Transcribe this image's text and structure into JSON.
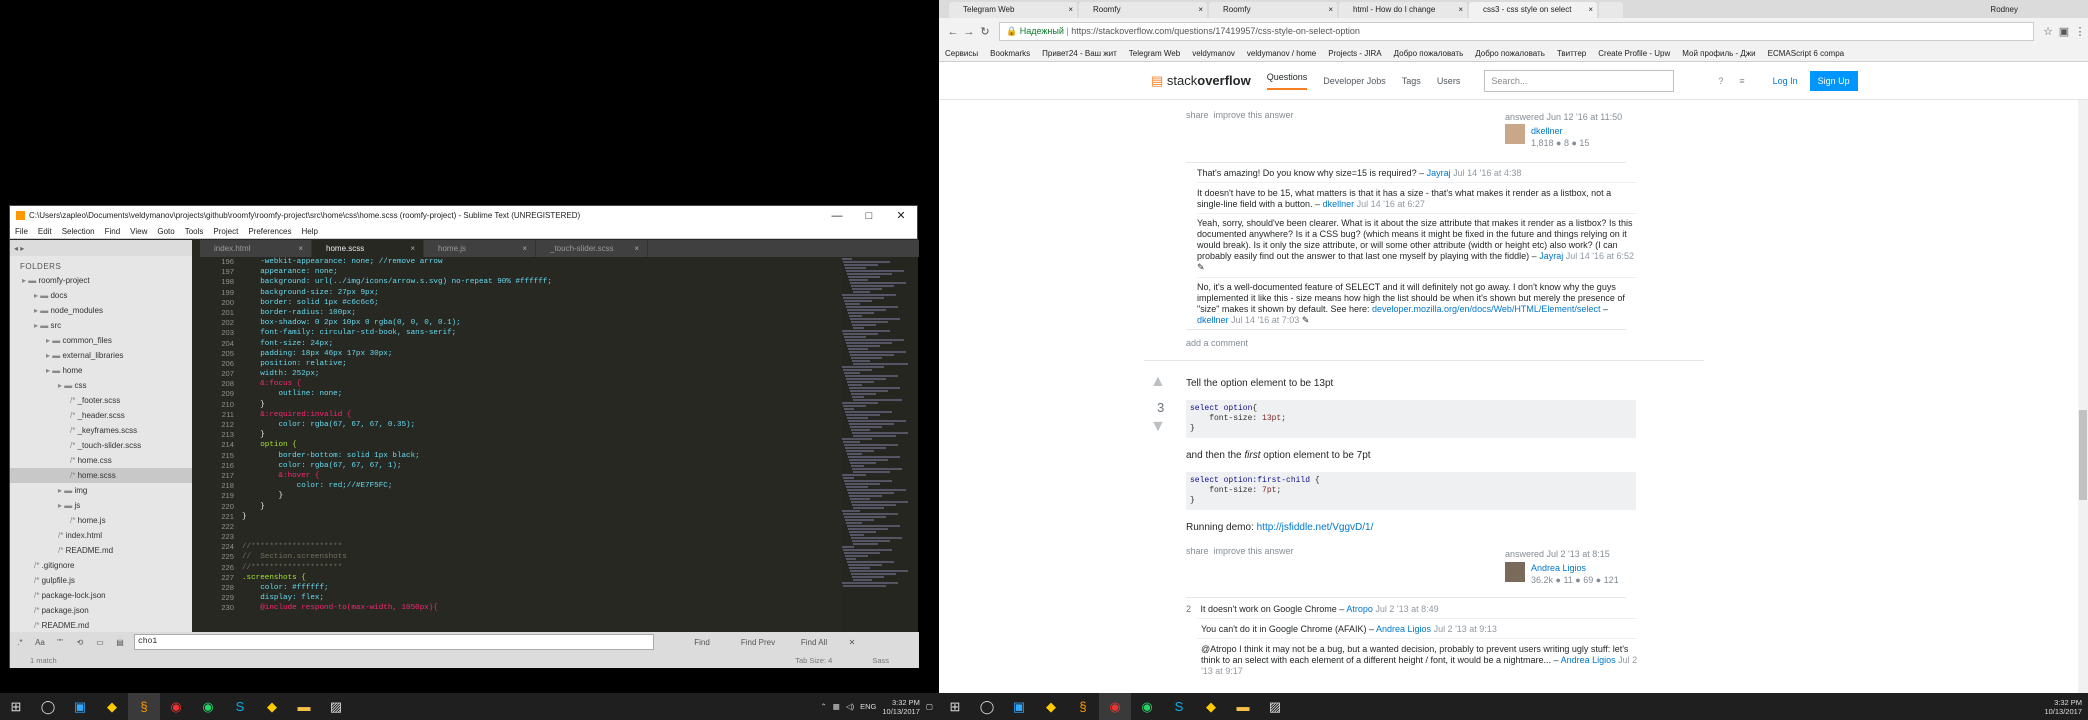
{
  "sublime": {
    "title": "C:\\Users\\zapleo\\Documents\\veldymanov\\projects\\github\\roomfy\\roomfy-project\\src\\home\\css\\home.scss (roomfy-project) - Sublime Text (UNREGISTERED)",
    "menu": [
      "File",
      "Edit",
      "Selection",
      "Find",
      "View",
      "Goto",
      "Tools",
      "Project",
      "Preferences",
      "Help"
    ],
    "folders_heading": "FOLDERS",
    "tree": [
      {
        "label": "roomfy-project",
        "indent": 1,
        "sel": false
      },
      {
        "label": "docs",
        "indent": 2,
        "sel": false
      },
      {
        "label": "node_modules",
        "indent": 2,
        "sel": false
      },
      {
        "label": "src",
        "indent": 2,
        "sel": false
      },
      {
        "label": "common_files",
        "indent": 3,
        "sel": false
      },
      {
        "label": "external_libraries",
        "indent": 3,
        "sel": false
      },
      {
        "label": "home",
        "indent": 3,
        "sel": false
      },
      {
        "label": "css",
        "indent": 4,
        "sel": false
      },
      {
        "label": "_footer.scss",
        "indent": 5,
        "sel": false
      },
      {
        "label": "_header.scss",
        "indent": 5,
        "sel": false
      },
      {
        "label": "_keyframes.scss",
        "indent": 5,
        "sel": false
      },
      {
        "label": "_touch-slider.scss",
        "indent": 5,
        "sel": false
      },
      {
        "label": "home.css",
        "indent": 5,
        "sel": false
      },
      {
        "label": "home.scss",
        "indent": 5,
        "sel": true
      },
      {
        "label": "img",
        "indent": 4,
        "sel": false
      },
      {
        "label": "js",
        "indent": 4,
        "sel": false
      },
      {
        "label": "home.js",
        "indent": 5,
        "sel": false
      },
      {
        "label": "index.html",
        "indent": 4,
        "sel": false
      },
      {
        "label": "README.md",
        "indent": 4,
        "sel": false
      },
      {
        "label": ".gitignore",
        "indent": 2,
        "sel": false
      },
      {
        "label": "gulpfile.js",
        "indent": 2,
        "sel": false
      },
      {
        "label": "package-lock.json",
        "indent": 2,
        "sel": false
      },
      {
        "label": "package.json",
        "indent": 2,
        "sel": false
      },
      {
        "label": "README.md",
        "indent": 2,
        "sel": false
      }
    ],
    "tabs": [
      {
        "label": "index.html",
        "active": false
      },
      {
        "label": "home.scss",
        "active": true
      },
      {
        "label": "home.js",
        "active": false
      },
      {
        "label": "_touch-slider.scss",
        "active": false
      }
    ],
    "line_start": 196,
    "code_lines": [
      "    -webkit-appearance: none; //remove arrow",
      "    appearance: none;",
      "    background: url(../img/icons/arrow.s.svg) no-repeat 90% #ffffff;",
      "    background-size: 27px 9px;",
      "    border: solid 1px #c6c6c6;",
      "    border-radius: 100px;",
      "    box-shadow: 0 2px 10px 0 rgba(0, 0, 0, 0.1);",
      "    font-family: circular-std-book, sans-serif;",
      "    font-size: 24px;",
      "    padding: 18px 46px 17px 30px;",
      "    position: relative;",
      "    width: 252px;",
      "    &:focus {",
      "        outline: none;",
      "    }",
      "    &:required:invalid {",
      "        color: rgba(67, 67, 67, 0.35);",
      "    }",
      "    option {",
      "        border-bottom: solid 1px black;",
      "        color: rgba(67, 67, 67, 1);",
      "        &:hover {",
      "            color: red;//#E7F5FC;",
      "        }",
      "    }",
      "}",
      "",
      "",
      "//********************",
      "//  Section.screenshots",
      "//********************",
      ".screenshots {",
      "    color: #ffffff;",
      "    display: flex;",
      "    @include respond-to(max-width, 1050px){"
    ],
    "find_value": "cho1",
    "find_btn": "Find",
    "find_prev_btn": "Find Prev",
    "find_all_btn": "Find All",
    "status_left": "1 match",
    "status_tab": "Tab Size: 4",
    "status_syntax": "Sass"
  },
  "taskbar": {
    "lang": "ENG",
    "time": "3:32 PM",
    "date": "10/13/2017"
  },
  "browser": {
    "tabs": [
      {
        "label": "Telegram Web",
        "active": false
      },
      {
        "label": "Roomfy",
        "active": false
      },
      {
        "label": "Roomfy",
        "active": false
      },
      {
        "label": "html - How do I change",
        "active": false
      },
      {
        "label": "css3 - css style on select",
        "active": true
      }
    ],
    "user": "Rodney",
    "secure_label": "Надежный",
    "url": "https://stackoverflow.com/questions/17419957/css-style-on-select-option",
    "bookmarks": [
      "Сервисы",
      "Bookmarks",
      "Привет24 - Ваш жит",
      "Telegram Web",
      "veldymanov",
      "veldymanov / home",
      "Projects - JIRA",
      "Добро пожаловать",
      "Добро пожаловать",
      "Твиттер",
      "Create Profile - Upw",
      "Мой профиль - Джи",
      "ECMAScript 6 compa"
    ]
  },
  "so": {
    "logo_a": "stack",
    "logo_b": "overflow",
    "nav": [
      "Questions",
      "Developer Jobs",
      "Tags",
      "Users"
    ],
    "search_placeholder": "Search...",
    "login": "Log In",
    "signup": "Sign Up",
    "ans1": {
      "share": "share",
      "improve": "improve this answer",
      "answered": "answered Jun 12 '16 at 11:50",
      "user": "dkellner",
      "rep": "1,818 ● 8 ● 15"
    },
    "comments1": [
      {
        "text": "That's amazing! Do you know why size=15 is required? –",
        "user": "Jayraj",
        "date": "Jul 14 '16 at 4:38"
      },
      {
        "text": "It doesn't have to be 15, what matters is that it has a size - that's what makes it render as a listbox, not a single-line field with a button. –",
        "user": "dkellner",
        "date": "Jul 14 '16 at 6:27"
      },
      {
        "text": "Yeah, sorry, should've been clearer. What is it about the size attribute that makes it render as a listbox? Is this documented anywhere? Is it a CSS bug? (which means it might be fixed in the future and things relying on it would break). Is it only the size attribute, or will some other attribute (width or height etc) also work? (I can probably easily find out the answer to that last one myself by playing with the fiddle) –",
        "user": "Jayraj",
        "date": "Jul 14 '16 at 6:52"
      },
      {
        "text": "No, it's a well-documented feature of SELECT and it will definitely not go away. I don't know why the guys implemented it like this - size means how high the list should be when it's shown but merely the presence of \"size\" makes it shown by default. See here:",
        "link": "developer.mozilla.org/en/docs/Web/HTML/Element/select",
        "user": "dkellner",
        "date": "Jul 14 '16 at 7:03"
      }
    ],
    "add_comment": "add a comment",
    "ans2": {
      "votes": "3",
      "p1": "Tell the option element to be 13pt",
      "code1_sel": "select option",
      "code1_prop": "font-size",
      "code1_val": "13pt",
      "p2_a": "and then the ",
      "p2_em": "first",
      "p2_b": " option element to be 7pt",
      "code2_sel": "select option:first-child",
      "code2_prop": "font-size",
      "code2_val": "7pt",
      "demo_label": "Running demo:",
      "demo_link": "http://jsfiddle.net/VggvD/1/",
      "share": "share",
      "improve": "improve this answer",
      "answered": "answered Jul 2 '13 at 8:15",
      "user": "Andrea Ligios",
      "rep": "36.2k ● 11 ● 69 ● 121"
    },
    "comments2": [
      {
        "score": "2",
        "text": "It doesn't work on Google Chrome –",
        "user": "Atropo",
        "date": "Jul 2 '13 at 8:49"
      },
      {
        "score": "",
        "text": "You can't do it in Google Chrome (AFAIK) –",
        "user": "Andrea Ligios",
        "date": "Jul 2 '13 at 9:13"
      },
      {
        "score": "",
        "text": "@Atropo I think it may not be a bug, but a wanted decision, probably to prevent users writing ugly stuff: let's think to an select with each element of a different height / font, it would be a nightmare... –",
        "user": "Andrea Ligios",
        "date": "Jul 2 '13 at 9:17"
      }
    ]
  }
}
